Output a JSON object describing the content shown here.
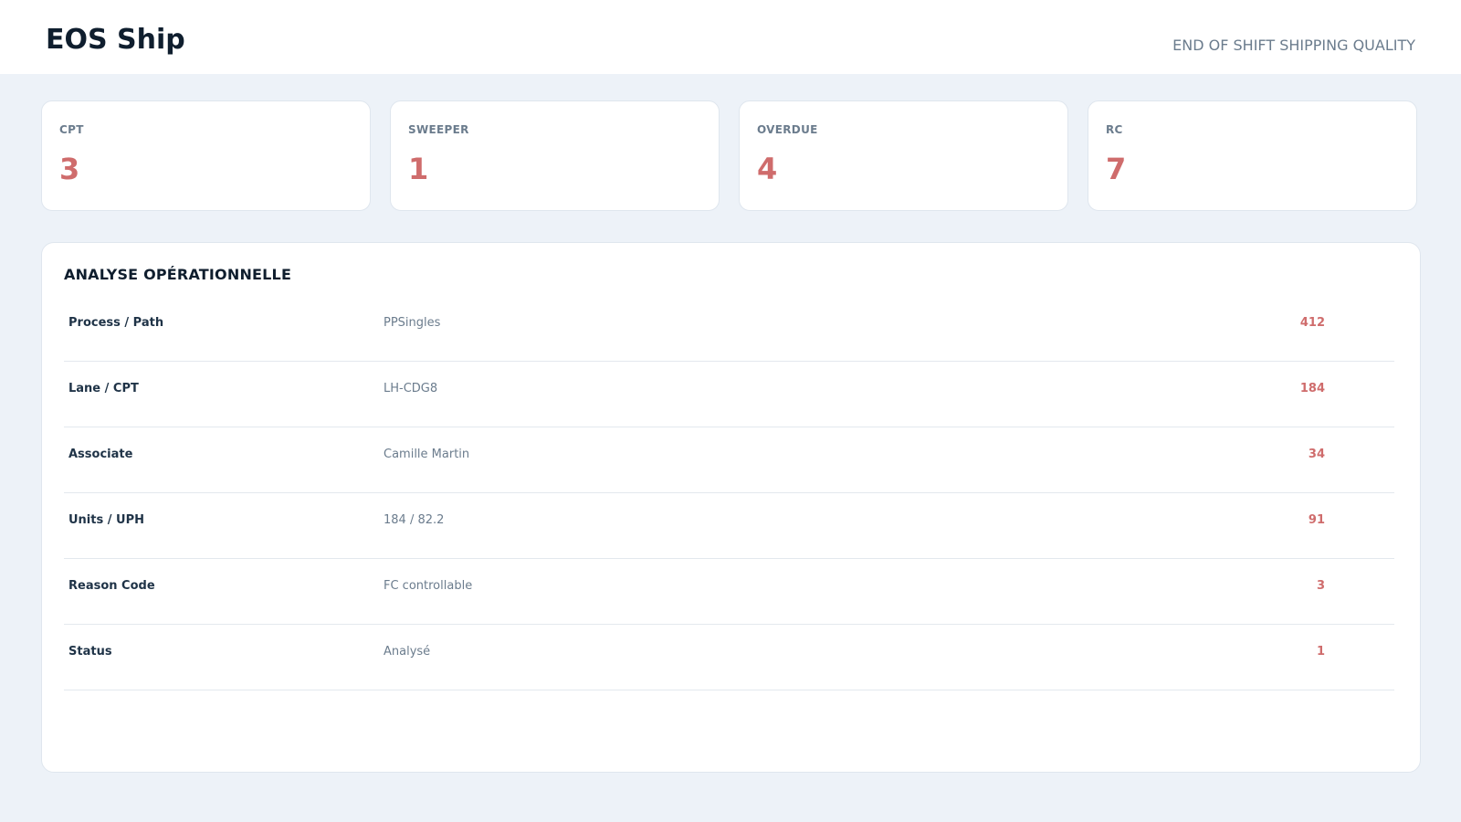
{
  "header": {
    "title": "EOS Ship",
    "subtitle": "END OF SHIFT SHIPPING QUALITY"
  },
  "kpis": [
    {
      "label": "CPT",
      "value": "3"
    },
    {
      "label": "SWEEPER",
      "value": "1"
    },
    {
      "label": "OVERDUE",
      "value": "4"
    },
    {
      "label": "RC",
      "value": "7"
    }
  ],
  "panel": {
    "title": "ANALYSE OPÉRATIONNELLE",
    "rows": [
      {
        "label": "Process / Path",
        "detail": "PPSingles",
        "value": "412"
      },
      {
        "label": "Lane / CPT",
        "detail": "LH-CDG8",
        "value": "184"
      },
      {
        "label": "Associate",
        "detail": "Camille Martin",
        "value": "34"
      },
      {
        "label": "Units / UPH",
        "detail": "184 / 82.2",
        "value": "91"
      },
      {
        "label": "Reason Code",
        "detail": "FC controllable",
        "value": "3"
      },
      {
        "label": "Status",
        "detail": "Analysé",
        "value": "1"
      }
    ]
  },
  "colors": {
    "background": "#edf2f8",
    "accent": "#cf6c6c",
    "title": "#0f1e2e",
    "muted": "#6b7c8d"
  }
}
